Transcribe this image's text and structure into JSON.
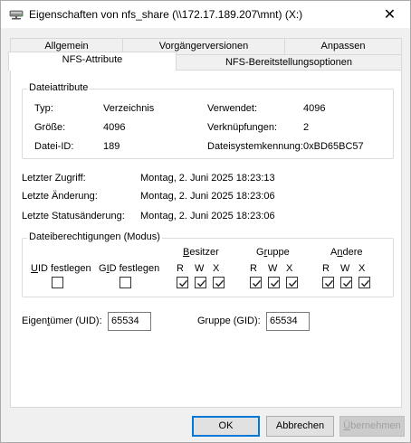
{
  "window": {
    "title": "Eigenschaften von nfs_share (\\\\172.17.189.207\\mnt) (X:)",
    "close_glyph": "✕"
  },
  "tabs": {
    "row1": [
      "Allgemein",
      "Vorgängerversionen",
      "Anpassen"
    ],
    "row2": [
      "NFS-Attribute",
      "NFS-Bereitstellungsoptionen"
    ],
    "active": "NFS-Attribute"
  },
  "file_attributes": {
    "group_title": "Dateiattribute",
    "type_label": "Typ:",
    "type_value": "Verzeichnis",
    "size_label": "Größe:",
    "size_value": "4096",
    "fileid_label": "Datei-ID:",
    "fileid_value": "189",
    "used_label": "Verwendet:",
    "used_value": "4096",
    "links_label": "Verknüpfungen:",
    "links_value": "2",
    "fsid_label": "Dateisystemkennung:",
    "fsid_value": "0xBD65BC57"
  },
  "times": {
    "access_label": "Letzter Zugriff:",
    "access_value": "Montag, 2. Juni 2025 18:23:13",
    "modify_label": "Letzte Änderung:",
    "modify_value": "Montag, 2. Juni 2025 18:23:06",
    "status_label": "Letzte Statusänderung:",
    "status_value": "Montag, 2. Juni 2025 18:23:06"
  },
  "permissions": {
    "group_title": "Dateiberechtigungen (Modus)",
    "uid_set_label_u": "U",
    "uid_set_label_rest": "ID festlegen",
    "gid_set_label_pre": "G",
    "gid_set_label_u": "I",
    "gid_set_label_rest": "D festlegen",
    "uid_set_checked": false,
    "gid_set_checked": false,
    "owner_title_u": "B",
    "owner_title_rest": "esitzer",
    "group_title_pre": "G",
    "group_title_u": "r",
    "group_title_rest": "uppe",
    "others_title_pre": "A",
    "others_title_u": "n",
    "others_title_rest": "dere",
    "r": "R",
    "w": "W",
    "x": "X",
    "owner": {
      "r": true,
      "w": true,
      "x": true
    },
    "group": {
      "r": true,
      "w": true,
      "x": true
    },
    "others": {
      "r": true,
      "w": true,
      "x": true
    }
  },
  "ownership": {
    "owner_label_pre": "Eigen",
    "owner_label_u": "t",
    "owner_label_rest": "ümer (UID):",
    "owner_value": "65534",
    "group_label": "Gruppe (GID):",
    "group_value": "65534"
  },
  "buttons": {
    "ok": "OK",
    "cancel": "Abbrechen",
    "apply_u": "Ü",
    "apply_rest": "bernehmen"
  }
}
